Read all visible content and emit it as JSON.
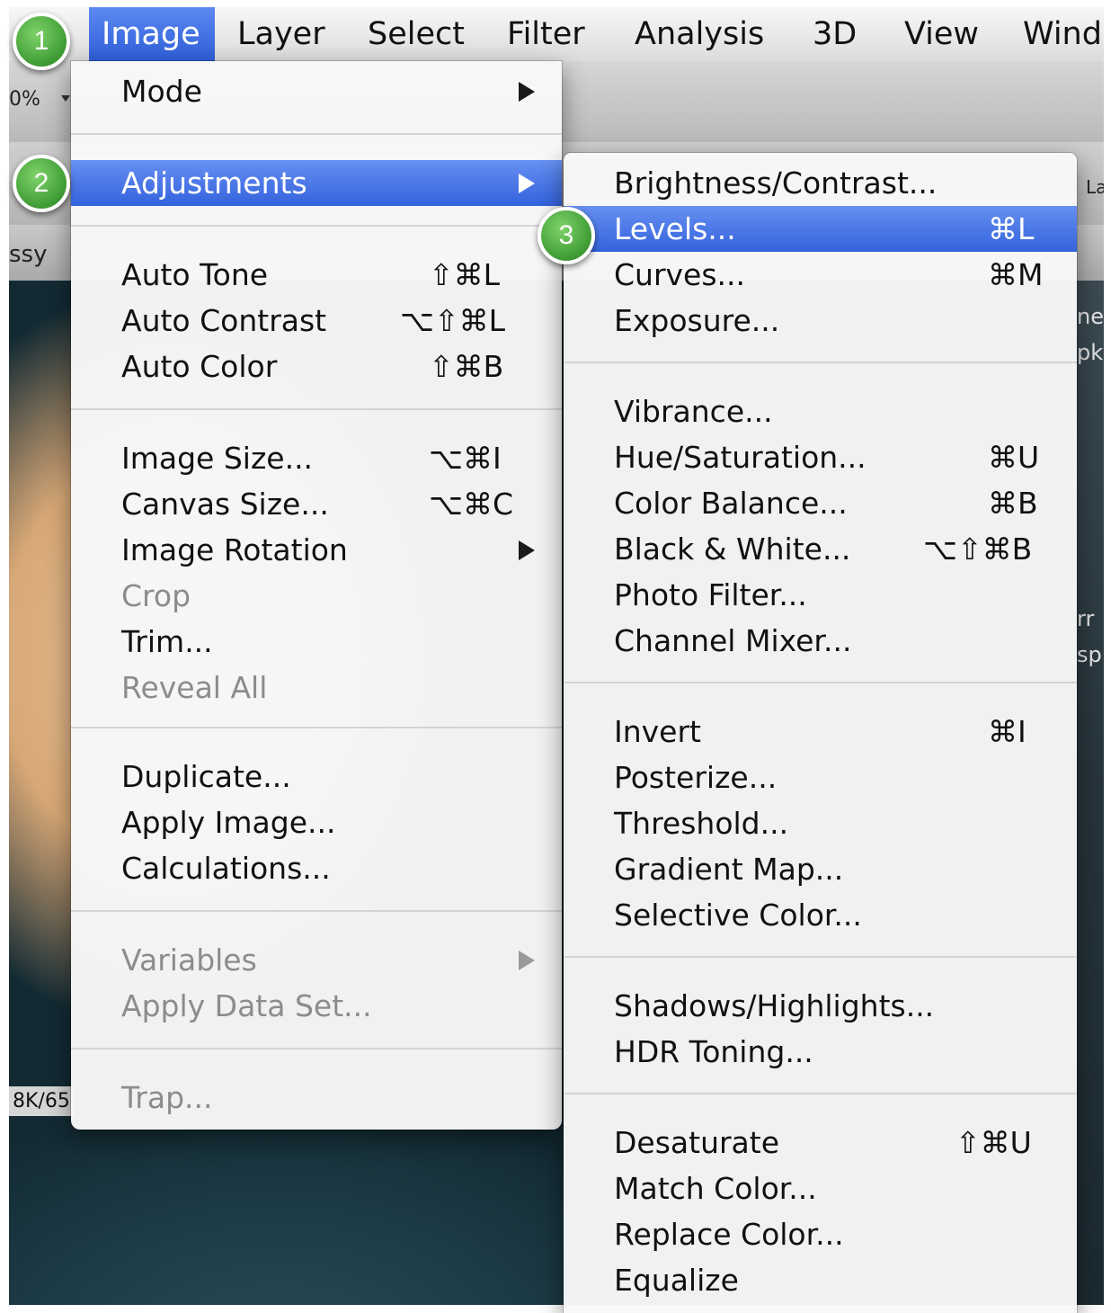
{
  "menubar": {
    "items": [
      {
        "label": "Image",
        "active": true
      },
      {
        "label": "Layer"
      },
      {
        "label": "Select"
      },
      {
        "label": "Filter"
      },
      {
        "label": "Analysis"
      },
      {
        "label": "3D"
      },
      {
        "label": "View"
      },
      {
        "label": "Wind"
      }
    ]
  },
  "options_bar": {
    "zoom_text": "0%"
  },
  "document_tab": {
    "title_fragment": "ssy"
  },
  "status_bar": {
    "text": "8K/65"
  },
  "background_labels": [
    "La",
    "ne",
    "pk",
    "rr",
    "sp"
  ],
  "image_menu": {
    "items": [
      {
        "label": "Mode",
        "submenu": true
      },
      {
        "label": "Adjustments",
        "submenu": true,
        "highlighted": true
      },
      {
        "label": "Auto Tone",
        "shortcut": "⇧⌘L"
      },
      {
        "label": "Auto Contrast",
        "shortcut": "⌥⇧⌘L"
      },
      {
        "label": "Auto Color",
        "shortcut": "⇧⌘B"
      },
      {
        "label": "Image Size...",
        "shortcut": "⌥⌘I"
      },
      {
        "label": "Canvas Size...",
        "shortcut": "⌥⌘C"
      },
      {
        "label": "Image Rotation",
        "submenu": true
      },
      {
        "label": "Crop",
        "disabled": true
      },
      {
        "label": "Trim..."
      },
      {
        "label": "Reveal All",
        "disabled": true
      },
      {
        "label": "Duplicate..."
      },
      {
        "label": "Apply Image..."
      },
      {
        "label": "Calculations..."
      },
      {
        "label": "Variables",
        "submenu": true,
        "disabled": true
      },
      {
        "label": "Apply Data Set...",
        "disabled": true
      },
      {
        "label": "Trap...",
        "disabled": true
      }
    ]
  },
  "adjustments_menu": {
    "items": [
      {
        "label": "Brightness/Contrast..."
      },
      {
        "label": "Levels...",
        "shortcut": "⌘L",
        "highlighted": true
      },
      {
        "label": "Curves...",
        "shortcut": "⌘M"
      },
      {
        "label": "Exposure..."
      },
      {
        "label": "Vibrance..."
      },
      {
        "label": "Hue/Saturation...",
        "shortcut": "⌘U"
      },
      {
        "label": "Color Balance...",
        "shortcut": "⌘B"
      },
      {
        "label": "Black & White...",
        "shortcut": "⌥⇧⌘B"
      },
      {
        "label": "Photo Filter..."
      },
      {
        "label": "Channel Mixer..."
      },
      {
        "label": "Invert",
        "shortcut": "⌘I"
      },
      {
        "label": "Posterize..."
      },
      {
        "label": "Threshold..."
      },
      {
        "label": "Gradient Map..."
      },
      {
        "label": "Selective Color..."
      },
      {
        "label": "Shadows/Highlights..."
      },
      {
        "label": "HDR Toning..."
      },
      {
        "label": "Desaturate",
        "shortcut": "⇧⌘U"
      },
      {
        "label": "Match Color..."
      },
      {
        "label": "Replace Color..."
      },
      {
        "label": "Equalize"
      }
    ]
  },
  "step_badges": [
    "1",
    "2",
    "3"
  ],
  "colors": {
    "highlight": "#3362dc",
    "badge": "#3e9b34"
  }
}
